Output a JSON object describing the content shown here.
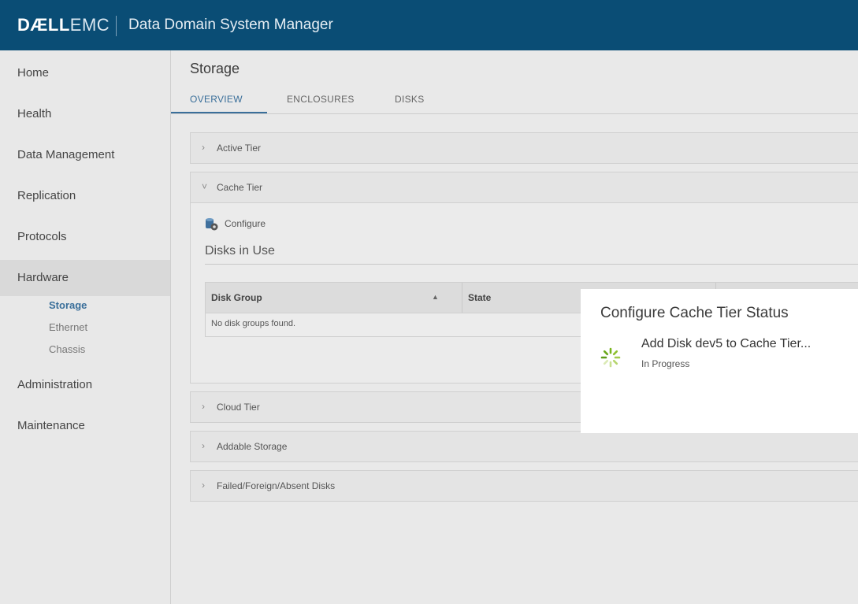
{
  "header": {
    "brand_bold": "DÆLL",
    "brand_light": "EMC",
    "title": "Data Domain System Manager"
  },
  "sidebar": {
    "items": [
      "Home",
      "Health",
      "Data Management",
      "Replication",
      "Protocols",
      "Hardware",
      "Administration",
      "Maintenance"
    ],
    "active": "Hardware",
    "sub_items": [
      "Storage",
      "Ethernet",
      "Chassis"
    ],
    "active_sub": "Storage"
  },
  "main": {
    "title": "Storage",
    "tabs": [
      "OVERVIEW",
      "ENCLOSURES",
      "DISKS"
    ],
    "active_tab": "OVERVIEW",
    "panels": [
      "Active Tier",
      "Cache Tier",
      "Cloud Tier",
      "Addable Storage",
      "Failed/Foreign/Absent Disks"
    ],
    "cache_tier": {
      "configure_label": "Configure",
      "section_title": "Disks in Use",
      "columns": [
        "Disk Group",
        "State"
      ],
      "empty_message": "No disk groups found."
    }
  },
  "modal": {
    "title": "Configure Cache Tier Status",
    "task": "Add Disk dev5 to Cache Tier...",
    "status": "In Progress"
  },
  "icons": {
    "chevron_right": "›",
    "chevron_down": "˅",
    "sort_up": "▲"
  },
  "colors": {
    "header": "#0a4d75",
    "accent": "#3a6f9a",
    "spinner": "#7ab51d"
  }
}
